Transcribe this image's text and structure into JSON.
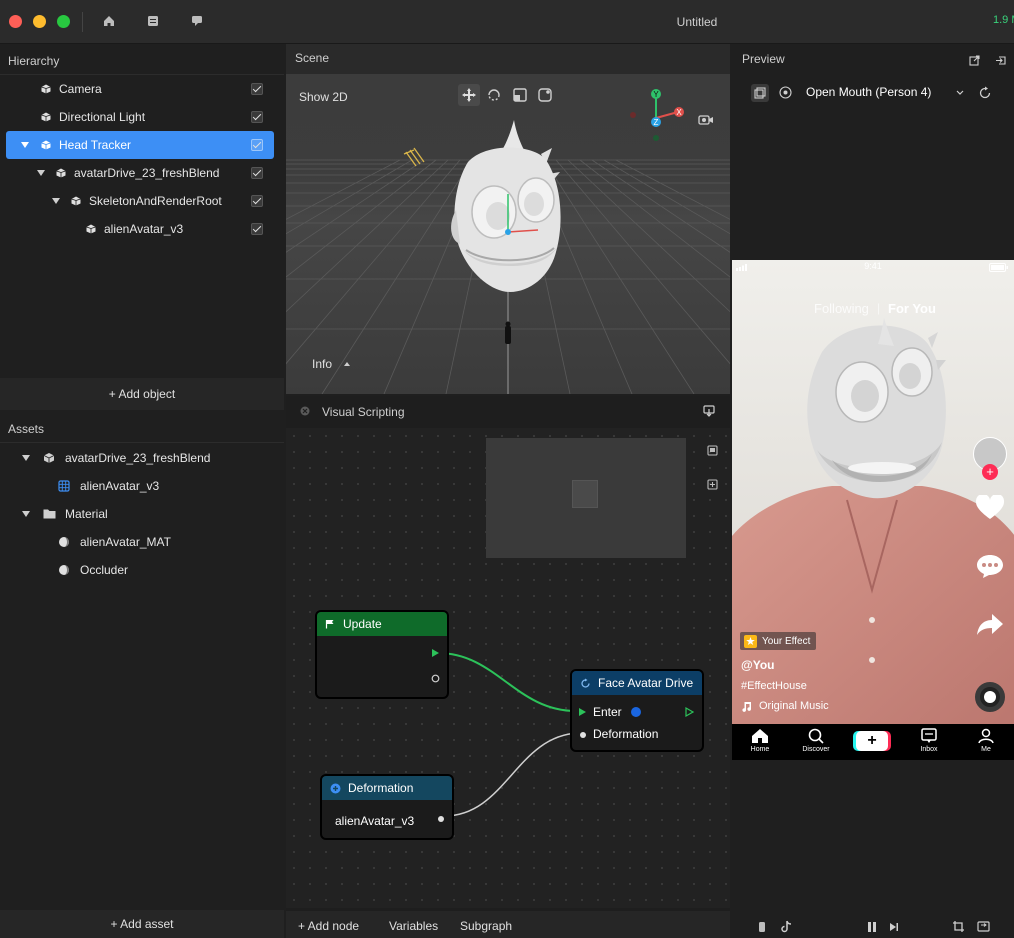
{
  "window": {
    "title": "Untitled",
    "fps": "1.9 M"
  },
  "titlebar_icons": [
    "home-icon",
    "document-icon",
    "chat-icon"
  ],
  "hierarchy": {
    "title": "Hierarchy",
    "items": [
      {
        "label": "Camera"
      },
      {
        "label": "Directional Light"
      },
      {
        "label": "Head Tracker"
      },
      {
        "label": "avatarDrive_23_freshBlend"
      },
      {
        "label": "SkeletonAndRenderRoot"
      },
      {
        "label": "alienAvatar_v3"
      }
    ],
    "add_label": "+ Add object"
  },
  "assets": {
    "title": "Assets",
    "items": [
      {
        "label": "avatarDrive_23_freshBlend"
      },
      {
        "label": "alienAvatar_v3"
      },
      {
        "label": "Material"
      },
      {
        "label": "alienAvatar_MAT"
      },
      {
        "label": "Occluder"
      }
    ],
    "add_label": "+ Add asset"
  },
  "scene": {
    "title": "Scene",
    "show2d": "Show 2D",
    "info_label": "Info",
    "gizmo_axes": {
      "y": "Y",
      "x": "X",
      "z": "Z"
    }
  },
  "visual_scripting": {
    "title": "Visual Scripting",
    "nodes": {
      "update": {
        "title": "Update"
      },
      "face_avatar_drive": {
        "title": "Face Avatar Drive",
        "enter": "Enter",
        "deformation": "Deformation"
      },
      "deformation": {
        "title": "Deformation",
        "value": "alienAvatar_v3"
      }
    },
    "toolbar": {
      "add_node": "+ Add node",
      "variables": "Variables",
      "subgraph": "Subgraph"
    }
  },
  "preview": {
    "title": "Preview",
    "selected_option": "Open Mouth (Person 4)",
    "phone": {
      "time": "9:41",
      "following": "Following",
      "separator": "|",
      "for_you": "For You",
      "effect_label": "Your Effect",
      "username": "@You",
      "hashtag": "#EffectHouse",
      "music": "Original Music",
      "nav": [
        "Home",
        "Discover",
        "",
        "Inbox",
        "Me"
      ]
    }
  },
  "colors": {
    "accent": "#3d8ff5",
    "update_header": "#0f6b2a",
    "drive_header": "#0c3e66",
    "deform_header": "#14475f",
    "wire": "#2cc25a"
  }
}
